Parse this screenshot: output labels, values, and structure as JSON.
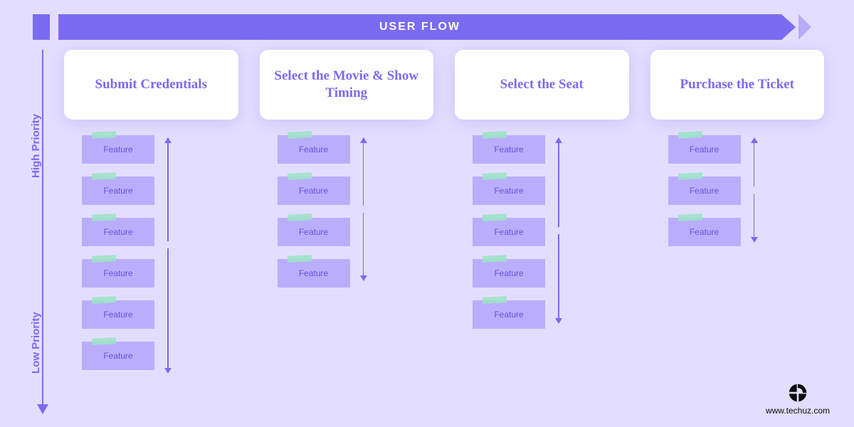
{
  "colors": {
    "bg": "#e3deff",
    "accent": "#7b6bf0",
    "accent_light": "#b8abfa",
    "card_bg": "#ffffff",
    "feature_bg": "#baaefc",
    "feature_text": "#6452df",
    "tape": "#9de3c8",
    "brand_black": "#0b0b0b"
  },
  "header": {
    "title": "USER FLOW"
  },
  "axis": {
    "high_label": "High Priority",
    "low_label": "Low Priority"
  },
  "columns": [
    {
      "id": "submit-credentials",
      "title": "Submit Credentials",
      "features": [
        "Feature",
        "Feature",
        "Feature",
        "Feature",
        "Feature",
        "Feature"
      ],
      "arrows": {
        "up_len": 145,
        "down_len": 175
      }
    },
    {
      "id": "select-movie",
      "title": "Select the Movie & Show Timing",
      "features": [
        "Feature",
        "Feature",
        "Feature",
        "Feature"
      ],
      "arrows": {
        "up_len": 95,
        "down_len": 95
      }
    },
    {
      "id": "select-seat",
      "title": "Select the Seat",
      "features": [
        "Feature",
        "Feature",
        "Feature",
        "Feature",
        "Feature"
      ],
      "arrows": {
        "up_len": 125,
        "down_len": 125
      }
    },
    {
      "id": "purchase-ticket",
      "title": "Purchase the Ticket",
      "features": [
        "Feature",
        "Feature",
        "Feature"
      ],
      "arrows": {
        "up_len": 68,
        "down_len": 68
      }
    }
  ],
  "brand": {
    "url": "www.techuz.com"
  }
}
